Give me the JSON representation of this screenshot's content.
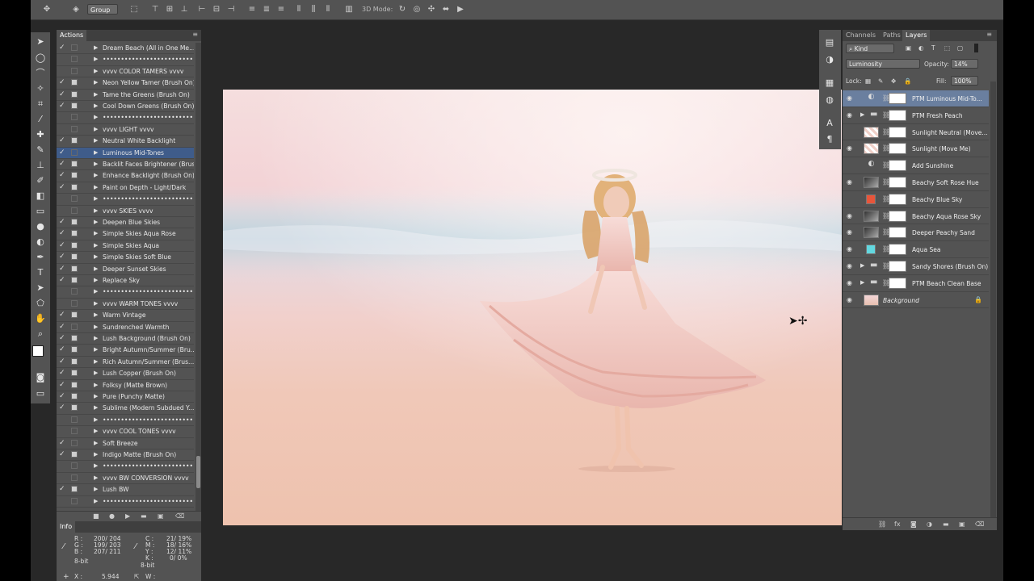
{
  "options_bar": {
    "group_label": "Group",
    "mode_3d_label": "3D Mode:"
  },
  "actions_panel": {
    "tab_label": "Actions",
    "rows": [
      {
        "label": "Dream Beach (All in One Me...",
        "checked": true,
        "dialog": false
      },
      {
        "label": "••••••••••••••••••••••••••••",
        "checked": false,
        "dialog": false
      },
      {
        "label": "vvvv  COLOR TAMERS  vvvv",
        "checked": false,
        "dialog": false
      },
      {
        "label": "Neon Yellow Tamer (Brush On)",
        "checked": true,
        "dialog": true
      },
      {
        "label": "Tame the Greens (Brush On)",
        "checked": true,
        "dialog": true
      },
      {
        "label": "Cool Down Greens (Brush On)",
        "checked": true,
        "dialog": true
      },
      {
        "label": "••••••••••••••••••••••••••••",
        "checked": false,
        "dialog": false
      },
      {
        "label": "vvvv  LIGHT  vvvv",
        "checked": false,
        "dialog": false
      },
      {
        "label": "Neutral White Backlight",
        "checked": true,
        "dialog": true
      },
      {
        "label": "Luminous Mid-Tones",
        "checked": true,
        "dialog": false,
        "selected": true
      },
      {
        "label": "Backlit Faces Brightener (Brus...",
        "checked": true,
        "dialog": true
      },
      {
        "label": "Enhance Backlight (Brush On)",
        "checked": true,
        "dialog": true
      },
      {
        "label": "Paint on Depth - Light/Dark",
        "checked": true,
        "dialog": true
      },
      {
        "label": "••••••••••••••••••••••••••••",
        "checked": false,
        "dialog": false
      },
      {
        "label": "vvvv  SKIES  vvvv",
        "checked": false,
        "dialog": false
      },
      {
        "label": "Deepen Blue Skies",
        "checked": true,
        "dialog": true
      },
      {
        "label": "Simple Skies Aqua Rose",
        "checked": true,
        "dialog": true
      },
      {
        "label": "Simple Skies Aqua",
        "checked": true,
        "dialog": true
      },
      {
        "label": "Simple Skies Soft Blue",
        "checked": true,
        "dialog": true
      },
      {
        "label": "Deeper Sunset Skies",
        "checked": true,
        "dialog": true
      },
      {
        "label": "Replace Sky",
        "checked": true,
        "dialog": true
      },
      {
        "label": "••••••••••••••••••••••••••••",
        "checked": false,
        "dialog": false
      },
      {
        "label": "vvvv  WARM TONES  vvvv",
        "checked": false,
        "dialog": false
      },
      {
        "label": "Warm Vintage",
        "checked": true,
        "dialog": true
      },
      {
        "label": "Sundrenched Warmth",
        "checked": true,
        "dialog": false
      },
      {
        "label": "Lush Background (Brush On)",
        "checked": true,
        "dialog": true
      },
      {
        "label": "Bright Autumn/Summer (Bru...",
        "checked": true,
        "dialog": true
      },
      {
        "label": "Rich Autumn/Summer (Brus...",
        "checked": true,
        "dialog": true
      },
      {
        "label": "Lush Copper (Brush On)",
        "checked": true,
        "dialog": true
      },
      {
        "label": "Folksy (Matte Brown)",
        "checked": true,
        "dialog": true
      },
      {
        "label": "Pure (Punchy Matte)",
        "checked": true,
        "dialog": true
      },
      {
        "label": "Sublime (Modern Subdued Y...",
        "checked": true,
        "dialog": true
      },
      {
        "label": "••••••••••••••••••••••••••••",
        "checked": false,
        "dialog": false
      },
      {
        "label": "vvvv  COOL TONES  vvvv",
        "checked": false,
        "dialog": false
      },
      {
        "label": "Soft Breeze",
        "checked": true,
        "dialog": false
      },
      {
        "label": "Indigo Matte (Brush On)",
        "checked": true,
        "dialog": true
      },
      {
        "label": "••••••••••••••••••••••••••••",
        "checked": false,
        "dialog": false
      },
      {
        "label": "vvvv  BW CONVERSION  vvvv",
        "checked": false,
        "dialog": false
      },
      {
        "label": "Lush BW",
        "checked": true,
        "dialog": true
      },
      {
        "label": "••••••••••••••••••••••••••••",
        "checked": false,
        "dialog": false
      }
    ]
  },
  "info_panel": {
    "tab_label": "Info",
    "r_label": "R :",
    "g_label": "G :",
    "b_label": "B :",
    "r_val": "200/ 204",
    "g_val": "199/ 203",
    "b_val": "207/ 211",
    "c_label": "C :",
    "m_label": "M :",
    "y_label": "Y :",
    "k_label": "K :",
    "c_val": "21/  19%",
    "m_val": "18/  16%",
    "y_val": "12/  11%",
    "k_val": "0/   0%",
    "bit_left": "8-bit",
    "bit_right": "8-bit",
    "x_label": "X :",
    "x_val": "5.944",
    "w_label": "W :"
  },
  "layers_panel": {
    "tabs": [
      "Channels",
      "Paths",
      "Layers"
    ],
    "filter_kind": "Kind",
    "blend_mode": "Luminosity",
    "opacity_label": "Opacity:",
    "opacity_value": "14%",
    "lock_label": "Lock:",
    "fill_label": "Fill:",
    "fill_value": "100%",
    "layers": [
      {
        "name": "PTM Luminous Mid-To...",
        "visible": true,
        "selected": true,
        "type": "adjustment"
      },
      {
        "name": "PTM Fresh Peach",
        "visible": true,
        "type": "group"
      },
      {
        "name": "Sunlight Neutral (Move...",
        "visible": false,
        "type": "pixel"
      },
      {
        "name": "Sunlight (Move Me)",
        "visible": true,
        "type": "pixel"
      },
      {
        "name": "Add Sunshine",
        "visible": false,
        "type": "adjustment"
      },
      {
        "name": "Beachy Soft Rose Hue",
        "visible": true,
        "type": "gradient"
      },
      {
        "name": "Beachy Blue Sky",
        "visible": false,
        "type": "fill",
        "color": "#e8553a"
      },
      {
        "name": "Beachy Aqua Rose Sky",
        "visible": true,
        "type": "gradient"
      },
      {
        "name": "Deeper Peachy Sand",
        "visible": true,
        "type": "gradient"
      },
      {
        "name": "Aqua Sea",
        "visible": true,
        "type": "fill",
        "color": "#62d8e0"
      },
      {
        "name": "Sandy Shores (Brush On)",
        "visible": true,
        "type": "group"
      },
      {
        "name": "PTM Beach Clean Base",
        "visible": true,
        "type": "group"
      },
      {
        "name": "Background",
        "visible": true,
        "type": "background"
      }
    ]
  },
  "colors": {
    "selection": "#3f5c8a",
    "layer_selection": "#6a7f9f",
    "panel_bg": "#535353",
    "workspace_bg": "#282828"
  }
}
